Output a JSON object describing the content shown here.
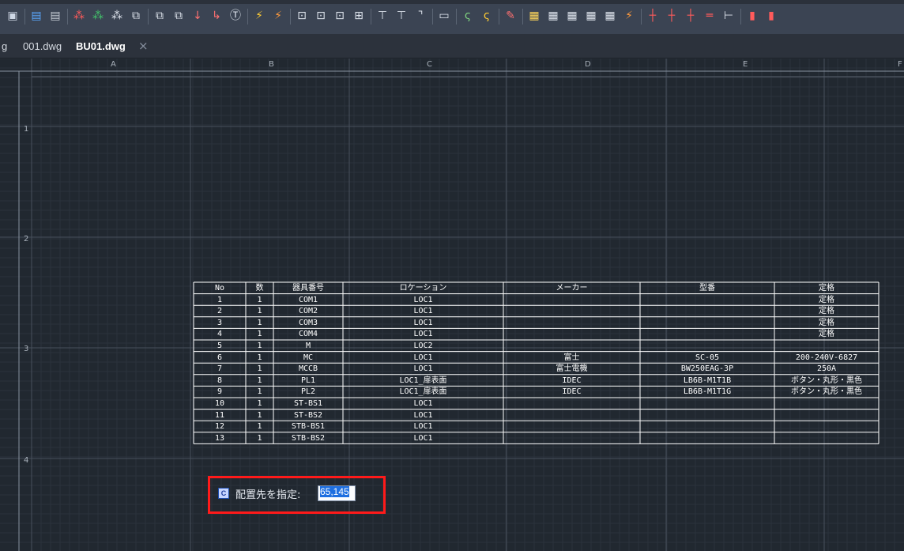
{
  "toolbar": {
    "buttons": [
      {
        "icon": "layout-icon",
        "glyph": "▣",
        "color": "#cfd8e6"
      },
      {
        "icon": "database-icon",
        "glyph": "▤",
        "color": "#5aa8ff"
      },
      {
        "icon": "database-gray-icon",
        "glyph": "▤",
        "color": "#c7cdd6"
      },
      {
        "icon": "array-red-icon",
        "glyph": "⁂",
        "color": "#ff5b5b"
      },
      {
        "icon": "array-green-icon",
        "glyph": "⁂",
        "color": "#43c46b"
      },
      {
        "icon": "array-dotted-icon",
        "glyph": "⁂",
        "color": "#dfe5ee"
      },
      {
        "icon": "array-box-icon",
        "glyph": "⧉",
        "color": "#dfe5ee"
      },
      {
        "icon": "copy-icon",
        "glyph": "⧉",
        "color": "#dfe5ee"
      },
      {
        "icon": "copy-alt-icon",
        "glyph": "⧉",
        "color": "#dfe5ee"
      },
      {
        "icon": "arrow-down-red-icon",
        "glyph": "↓",
        "color": "#ff7070"
      },
      {
        "icon": "arrow-down-corner-icon",
        "glyph": "↳",
        "color": "#ff7070"
      },
      {
        "icon": "tb-circle-icon",
        "glyph": "Ⓣ",
        "color": "#dfe5ee"
      },
      {
        "icon": "wand-icon",
        "glyph": "⚡",
        "color": "#ffcc33"
      },
      {
        "icon": "wand-alt-icon",
        "glyph": "⚡",
        "color": "#ff9a3c"
      },
      {
        "icon": "block-p-icon",
        "glyph": "⊡",
        "color": "#dfe5ee"
      },
      {
        "icon": "block-p2-icon",
        "glyph": "⊡",
        "color": "#dfe5ee"
      },
      {
        "icon": "block-edit-icon",
        "glyph": "⊡",
        "color": "#dfe5ee"
      },
      {
        "icon": "block-table-icon",
        "glyph": "⊞",
        "color": "#dfe5ee"
      },
      {
        "icon": "line-branch-icon",
        "glyph": "⊤",
        "color": "#dfe5ee"
      },
      {
        "icon": "line-branch2-icon",
        "glyph": "⊤",
        "color": "#dfe5ee"
      },
      {
        "icon": "line-corner-icon",
        "glyph": "⌝",
        "color": "#dfe5ee"
      },
      {
        "icon": "panel-icon",
        "glyph": "▭",
        "color": "#dfe5ee"
      },
      {
        "icon": "curve-icon",
        "glyph": "ς",
        "color": "#7fd37f"
      },
      {
        "icon": "curve-alt-icon",
        "glyph": "ς",
        "color": "#ffcc33"
      },
      {
        "icon": "pen-icon",
        "glyph": "✎",
        "color": "#ff7070"
      },
      {
        "icon": "grid-table-icon",
        "glyph": "▦",
        "color": "#ffd75a"
      },
      {
        "icon": "grid-table2-icon",
        "glyph": "▦",
        "color": "#dfe5ee"
      },
      {
        "icon": "grid-table3-icon",
        "glyph": "▦",
        "color": "#dfe5ee"
      },
      {
        "icon": "grid-table4-icon",
        "glyph": "▦",
        "color": "#dfe5ee"
      },
      {
        "icon": "grid-table5-icon",
        "glyph": "▦",
        "color": "#dfe5ee"
      },
      {
        "icon": "wand-table-icon",
        "glyph": "⚡",
        "color": "#ff9a3c"
      },
      {
        "icon": "cross-red-icon",
        "glyph": "┼",
        "color": "#ff5b5b"
      },
      {
        "icon": "cross-icon",
        "glyph": "┼",
        "color": "#ff5b5b"
      },
      {
        "icon": "tee-icon",
        "glyph": "┼",
        "color": "#ff5b5b"
      },
      {
        "icon": "equals-icon",
        "glyph": "═",
        "color": "#ff5b5b"
      },
      {
        "icon": "tee-right-icon",
        "glyph": "⊢",
        "color": "#dfe5ee"
      },
      {
        "icon": "page-red-icon",
        "glyph": "▮",
        "color": "#ff5b5b"
      },
      {
        "icon": "page-red2-icon",
        "glyph": "▮",
        "color": "#ff5b5b"
      }
    ]
  },
  "tabs": {
    "partial_label": "g",
    "tab1_label": "001.dwg",
    "tab2_label": "BU01.dwg",
    "close_glyph": "×"
  },
  "grid": {
    "columns": [
      "A",
      "B",
      "C",
      "D",
      "E",
      "F"
    ],
    "rows": [
      "1",
      "2",
      "3",
      "4"
    ]
  },
  "parts_table": {
    "headers": [
      "No",
      "数",
      "器具番号",
      "ロケーション",
      "メーカー",
      "型番",
      "定格"
    ],
    "rows": [
      {
        "no": "1",
        "qty": "1",
        "device": "COM1",
        "location": "LOC1",
        "maker": "",
        "model": "",
        "rating": "定格"
      },
      {
        "no": "2",
        "qty": "1",
        "device": "COM2",
        "location": "LOC1",
        "maker": "",
        "model": "",
        "rating": "定格"
      },
      {
        "no": "3",
        "qty": "1",
        "device": "COM3",
        "location": "LOC1",
        "maker": "",
        "model": "",
        "rating": "定格"
      },
      {
        "no": "4",
        "qty": "1",
        "device": "COM4",
        "location": "LOC1",
        "maker": "",
        "model": "",
        "rating": "定格"
      },
      {
        "no": "5",
        "qty": "1",
        "device": "M",
        "location": "LOC2",
        "maker": "",
        "model": "",
        "rating": ""
      },
      {
        "no": "6",
        "qty": "1",
        "device": "MC",
        "location": "LOC1",
        "maker": "富士",
        "model": "SC-05",
        "rating": "200-240V-6827"
      },
      {
        "no": "7",
        "qty": "1",
        "device": "MCCB",
        "location": "LOC1",
        "maker": "富士電機",
        "model": "BW250EAG-3P",
        "rating": "250A"
      },
      {
        "no": "8",
        "qty": "1",
        "device": "PL1",
        "location": "LOC1_扉表面",
        "maker": "IDEC",
        "model": "LB6B-M1T1B",
        "rating": "ボタン・丸形・黒色"
      },
      {
        "no": "9",
        "qty": "1",
        "device": "PL2",
        "location": "LOC1_扉表面",
        "maker": "IDEC",
        "model": "LB6B-M1T1G",
        "rating": "ボタン・丸形・黒色"
      },
      {
        "no": "10",
        "qty": "1",
        "device": "ST-BS1",
        "location": "LOC1",
        "maker": "",
        "model": "",
        "rating": ""
      },
      {
        "no": "11",
        "qty": "1",
        "device": "ST-BS2",
        "location": "LOC1",
        "maker": "",
        "model": "",
        "rating": ""
      },
      {
        "no": "12",
        "qty": "1",
        "device": "STB-BS1",
        "location": "LOC1",
        "maker": "",
        "model": "",
        "rating": ""
      },
      {
        "no": "13",
        "qty": "1",
        "device": "STB-BS2",
        "location": "LOC1",
        "maker": "",
        "model": "",
        "rating": ""
      }
    ]
  },
  "command": {
    "icon_glyph": "C",
    "prompt": "配置先を指定:",
    "value": "65,145"
  },
  "colors": {
    "highlight_box": "#ff1a1a",
    "input_selection": "#1e6fe0",
    "canvas_bg": "#212830"
  }
}
